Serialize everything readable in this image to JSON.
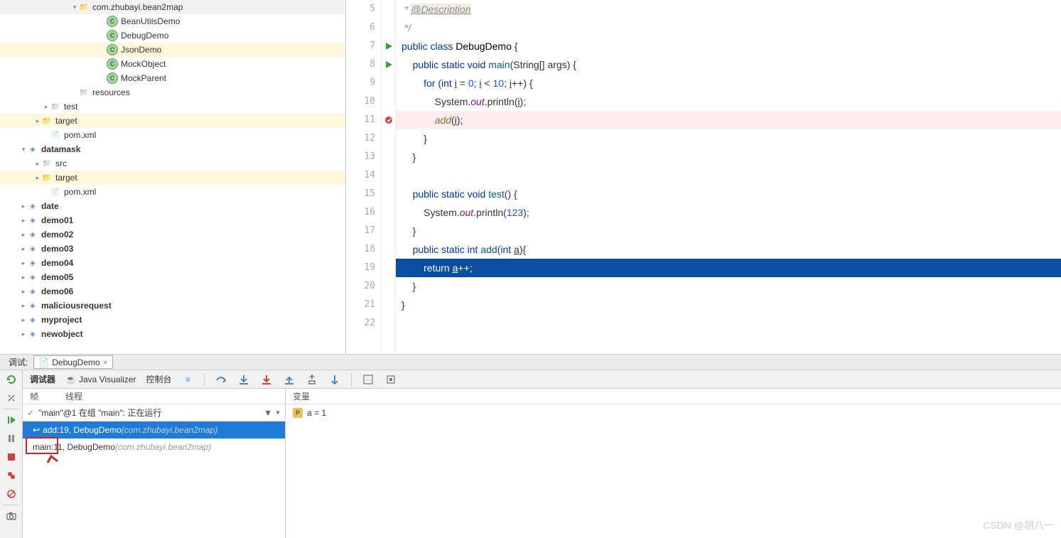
{
  "tree": {
    "items": [
      {
        "indent": 100,
        "arrow": "▾",
        "icon": "pkg",
        "label": "com.zhubayi.bean2map",
        "bold": false,
        "sel": false
      },
      {
        "indent": 140,
        "arrow": "",
        "icon": "class",
        "label": "BeanUtilsDemo",
        "sel": false
      },
      {
        "indent": 140,
        "arrow": "",
        "icon": "class",
        "label": "DebugDemo",
        "sel": false
      },
      {
        "indent": 140,
        "arrow": "",
        "icon": "class",
        "label": "JsonDemo",
        "sel": true
      },
      {
        "indent": 140,
        "arrow": "",
        "icon": "class",
        "label": "MockObject",
        "sel": false
      },
      {
        "indent": 140,
        "arrow": "",
        "icon": "class",
        "label": "MockParent",
        "sel": false
      },
      {
        "indent": 100,
        "arrow": "",
        "icon": "res",
        "label": "resources",
        "sel": false
      },
      {
        "indent": 60,
        "arrow": "▸",
        "icon": "folder",
        "label": "test",
        "sel": false
      },
      {
        "indent": 48,
        "arrow": "▸",
        "icon": "folderO",
        "label": "target",
        "sel": true
      },
      {
        "indent": 60,
        "arrow": "",
        "icon": "file",
        "label": "pom.xml",
        "sel": false
      },
      {
        "indent": 28,
        "arrow": "▾",
        "icon": "mod",
        "label": "datamask",
        "bold": true,
        "sel": false
      },
      {
        "indent": 48,
        "arrow": "▸",
        "icon": "folder",
        "label": "src",
        "sel": false
      },
      {
        "indent": 48,
        "arrow": "▸",
        "icon": "folderO",
        "label": "target",
        "sel": true
      },
      {
        "indent": 60,
        "arrow": "",
        "icon": "file",
        "label": "pom.xml",
        "sel": false
      },
      {
        "indent": 28,
        "arrow": "▸",
        "icon": "mod",
        "label": "date",
        "bold": true,
        "sel": false
      },
      {
        "indent": 28,
        "arrow": "▸",
        "icon": "mod",
        "label": "demo01",
        "bold": true,
        "sel": false
      },
      {
        "indent": 28,
        "arrow": "▸",
        "icon": "mod",
        "label": "demo02",
        "bold": true,
        "sel": false
      },
      {
        "indent": 28,
        "arrow": "▸",
        "icon": "mod",
        "label": "demo03",
        "bold": true,
        "sel": false
      },
      {
        "indent": 28,
        "arrow": "▸",
        "icon": "mod",
        "label": "demo04",
        "bold": true,
        "sel": false
      },
      {
        "indent": 28,
        "arrow": "▸",
        "icon": "mod",
        "label": "demo05",
        "bold": true,
        "sel": false
      },
      {
        "indent": 28,
        "arrow": "▸",
        "icon": "mod",
        "label": "demo06",
        "bold": true,
        "sel": false
      },
      {
        "indent": 28,
        "arrow": "▸",
        "icon": "mod",
        "label": "maliciousrequest",
        "bold": true,
        "sel": false
      },
      {
        "indent": 28,
        "arrow": "▸",
        "icon": "mod",
        "label": "myproject",
        "bold": true,
        "sel": false
      },
      {
        "indent": 28,
        "arrow": "▸",
        "icon": "mod",
        "label": "newobject",
        "bold": true,
        "sel": false
      }
    ]
  },
  "code": {
    "lines": [
      {
        "n": 5,
        "mark": "",
        "html": "<span class='cmt'> * </span><span class='desc'>@Description</span>"
      },
      {
        "n": 6,
        "mark": "",
        "html": "<span class='cmt'> */</span>"
      },
      {
        "n": 7,
        "mark": "run",
        "html": "<span class='kw'>public</span> <span class='kw'>class</span> <span class='cls'>DebugDemo</span> {"
      },
      {
        "n": 8,
        "mark": "run",
        "html": "    <span class='kw'>public</span> <span class='kw'>static</span> <span class='kw'>void</span> <span class='fn'>main</span>(String[] args) {"
      },
      {
        "n": 9,
        "mark": "",
        "html": "        <span class='kw'>for</span> (<span class='kw'>int</span> <u>i</u> = <span class='num'>0</span>; <u>i</u> &lt; <span class='num'>10</span>; <u>i</u>++) {"
      },
      {
        "n": 10,
        "mark": "",
        "html": "            System.<span class='fld'>out</span>.println(<u>i</u>);"
      },
      {
        "n": 11,
        "mark": "bp",
        "hl": true,
        "html": "            <span class='fnItal'>add</span>(<u>i</u>);"
      },
      {
        "n": 12,
        "mark": "",
        "html": "        }"
      },
      {
        "n": 13,
        "mark": "",
        "html": "    }"
      },
      {
        "n": 14,
        "mark": "",
        "html": ""
      },
      {
        "n": 15,
        "mark": "",
        "html": "    <span class='kw'>public</span> <span class='kw'>static</span> <span class='kw'>void</span> <span class='fn'>test</span>() {"
      },
      {
        "n": 16,
        "mark": "",
        "html": "        System.<span class='fld'>out</span>.println(<span class='num'>123</span>);"
      },
      {
        "n": 17,
        "mark": "",
        "html": "    }"
      },
      {
        "n": 18,
        "mark": "",
        "html": "    <span class='kw'>public</span> <span class='kw'>static</span> <span class='kw'>int</span> <span class='fn'>add</span>(<span class='kw'>int</span> <u>a</u>){"
      },
      {
        "n": 19,
        "mark": "",
        "cur": true,
        "html": "        <span class='kw'>return</span> <u>a</u>++;"
      },
      {
        "n": 20,
        "mark": "",
        "html": "    }"
      },
      {
        "n": 21,
        "mark": "",
        "html": "}"
      },
      {
        "n": 22,
        "mark": "",
        "html": ""
      }
    ]
  },
  "debug": {
    "tab_label": "调试:",
    "tab_file": "DebugDemo",
    "t_debugger": "调试器",
    "t_visualizer": "Java Visualizer",
    "t_console": "控制台",
    "h_frames": "帧",
    "h_threads": "线程",
    "h_vars": "变量",
    "thread": "\"main\"@1 在组 \"main\": 正在运行",
    "frame0_m": "add:19, DebugDemo ",
    "frame0_p": "(com.zhubayi.bean2map)",
    "frame1_m": "main:11, DebugDemo ",
    "frame1_p": "(com.zhubayi.bean2map)",
    "var_name": "a = 1"
  },
  "watermark": "CSDN @胡八一"
}
